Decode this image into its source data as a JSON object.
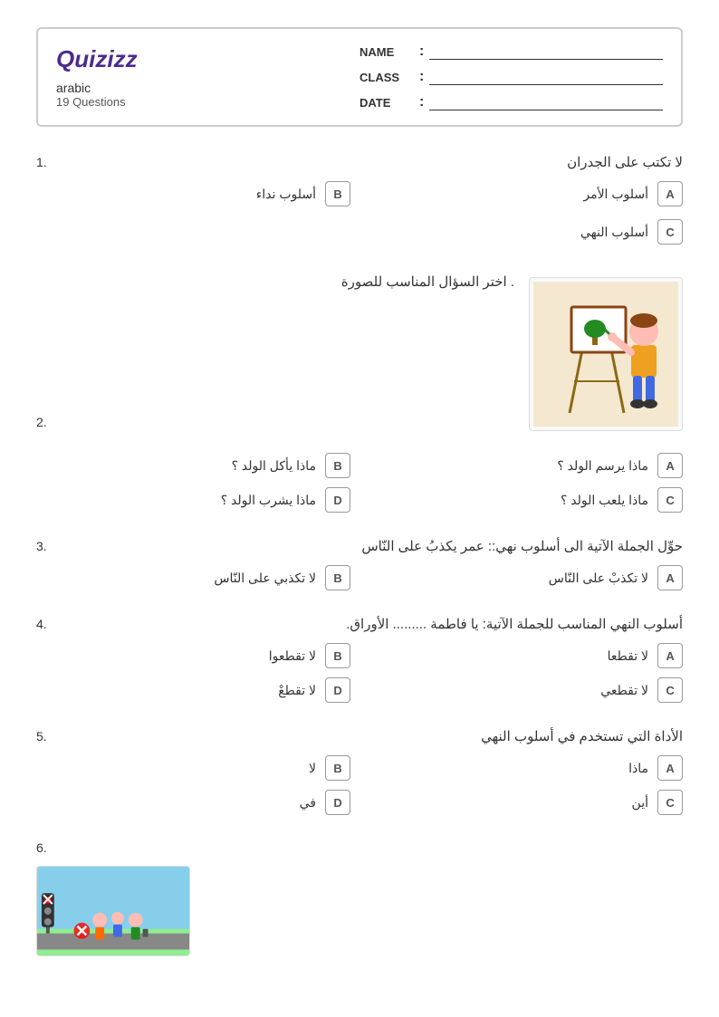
{
  "header": {
    "logo": "Quizizz",
    "quiz_title": "arabic",
    "quiz_questions": "19 Questions",
    "name_label": "NAME",
    "class_label": "CLASS",
    "date_label": "DATE"
  },
  "questions": [
    {
      "number": "1.",
      "text": "لا تكتب على الجدران",
      "options": [
        {
          "letter": "A",
          "text": "أسلوب الأمر"
        },
        {
          "letter": "B",
          "text": "أسلوب نداء"
        },
        {
          "letter": "C",
          "text": "أسلوب النهي"
        }
      ],
      "has_image": false
    },
    {
      "number": "2.",
      "text": ". اختر السؤال المناسب للصورة",
      "options": [
        {
          "letter": "A",
          "text": "ماذا يرسم الولد ؟"
        },
        {
          "letter": "B",
          "text": "ماذا يأكل الولد ؟"
        },
        {
          "letter": "C",
          "text": "ماذا يلعب الولد ؟"
        },
        {
          "letter": "D",
          "text": "ماذا يشرب الولد ؟"
        }
      ],
      "has_image": true,
      "image_type": "boy_painting"
    },
    {
      "number": "3.",
      "text": "حوِّل الجملة الآتية الى أسلوب نهي:: عمر يكذبُ على النّاس",
      "options": [
        {
          "letter": "A",
          "text": "لا تكذبْ على النّاس"
        },
        {
          "letter": "B",
          "text": "لا تكذبي على النّاس"
        }
      ],
      "has_image": false,
      "two_col": true
    },
    {
      "number": "4.",
      "text": "أسلوب النهي المناسب للجملة الآتية: يا فاطمة ......... الأوراق.",
      "options": [
        {
          "letter": "A",
          "text": "لا تقطعا"
        },
        {
          "letter": "B",
          "text": "لا تقطعوا"
        },
        {
          "letter": "C",
          "text": "لا تقطعي"
        },
        {
          "letter": "D",
          "text": "لا تقطعْ"
        }
      ],
      "has_image": false
    },
    {
      "number": "5.",
      "text": "الأداة التي تستخدم في أسلوب النهي",
      "options": [
        {
          "letter": "A",
          "text": "ماذا"
        },
        {
          "letter": "B",
          "text": "لا"
        },
        {
          "letter": "C",
          "text": "أين"
        },
        {
          "letter": "D",
          "text": "في"
        }
      ],
      "has_image": false
    },
    {
      "number": "6.",
      "text": "",
      "options": [],
      "has_image": true,
      "image_type": "traffic"
    }
  ]
}
